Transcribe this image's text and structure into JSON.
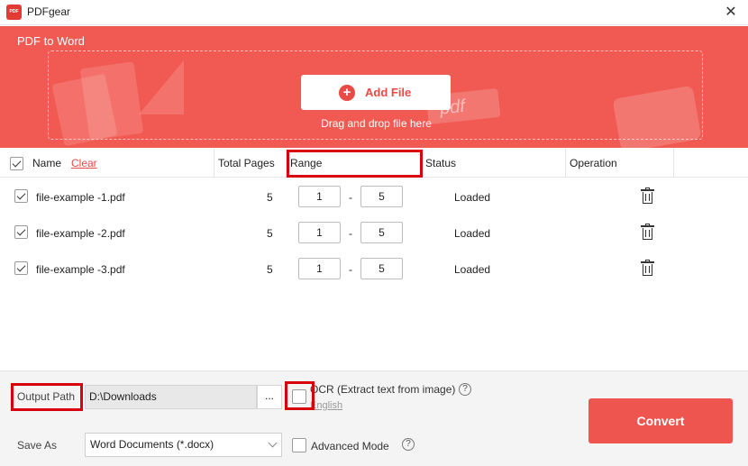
{
  "window": {
    "app_name": "PDFgear",
    "close_glyph": "✕",
    "logo_text": "PDF"
  },
  "banner": {
    "title": "PDF to Word",
    "add_file_label": "Add File",
    "drop_hint": "Drag and drop file here",
    "deco_pdf_text": "pdf",
    "bg_color": "#f15a52"
  },
  "table": {
    "headers": {
      "name": "Name",
      "clear": "Clear",
      "total_pages": "Total Pages",
      "range": "Range",
      "status": "Status",
      "operation": "Operation"
    },
    "range_separator": "-",
    "rows": [
      {
        "name": "file-example -1.pdf",
        "pages": "5",
        "from": "1",
        "to": "5",
        "status": "Loaded",
        "checked": true
      },
      {
        "name": "file-example -2.pdf",
        "pages": "5",
        "from": "1",
        "to": "5",
        "status": "Loaded",
        "checked": true
      },
      {
        "name": "file-example -3.pdf",
        "pages": "5",
        "from": "1",
        "to": "5",
        "status": "Loaded",
        "checked": true
      }
    ]
  },
  "bottom": {
    "output_path_label": "Output Path",
    "output_path_value": "D:\\Downloads",
    "browse_label": "...",
    "ocr_label": "OCR (Extract text from image)",
    "ocr_language": "English",
    "save_as_label": "Save As",
    "format_value": "Word Documents (*.docx)",
    "advanced_mode_label": "Advanced Mode",
    "convert_label": "Convert",
    "help_glyph": "?"
  },
  "colors": {
    "accent": "#ee554f",
    "highlight": "#d8000c"
  }
}
